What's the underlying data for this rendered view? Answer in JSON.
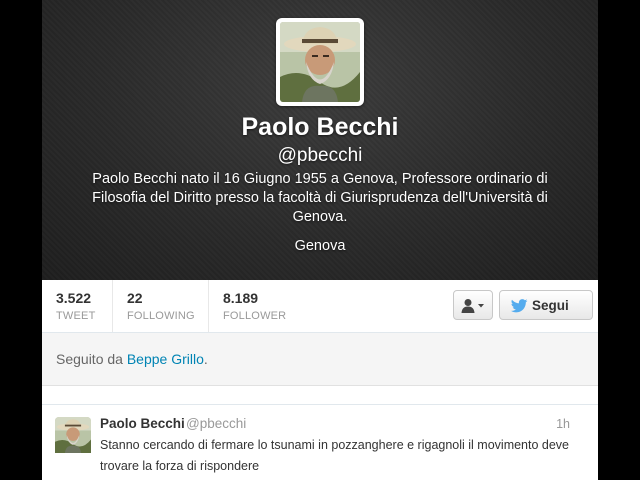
{
  "profile": {
    "name": "Paolo Becchi",
    "handle": "@pbecchi",
    "bio": "Paolo Becchi nato il 16 Giugno 1955 a Genova, Professore ordinario di Filosofia del Diritto presso la facoltà di Giurisprudenza dell'Università di Genova.",
    "location": "Genova",
    "avatar_icon": "profile-photo-man-with-hat"
  },
  "stats": [
    {
      "value": "3.522",
      "label": "TWEET"
    },
    {
      "value": "22",
      "label": "FOLLOWING"
    },
    {
      "value": "8.189",
      "label": "FOLLOWER"
    }
  ],
  "actions": {
    "user_menu_icon": "user-dropdown-icon",
    "follow_label": "Segui",
    "follow_icon": "twitter-bird-icon"
  },
  "followed_by": {
    "prefix": "Seguito da ",
    "user": "Beppe Grillo",
    "suffix": "."
  },
  "tweet": {
    "name": "Paolo Becchi",
    "handle": "@pbecchi",
    "time": "1h",
    "text": "Stanno cercando di fermare lo tsunami in pozzanghere e rigagnoli  il movimento deve trovare la forza di rispondere"
  },
  "colors": {
    "link": "#0084b4",
    "header_bg": "#2a2a2a",
    "twitter_blue": "#55acee"
  }
}
